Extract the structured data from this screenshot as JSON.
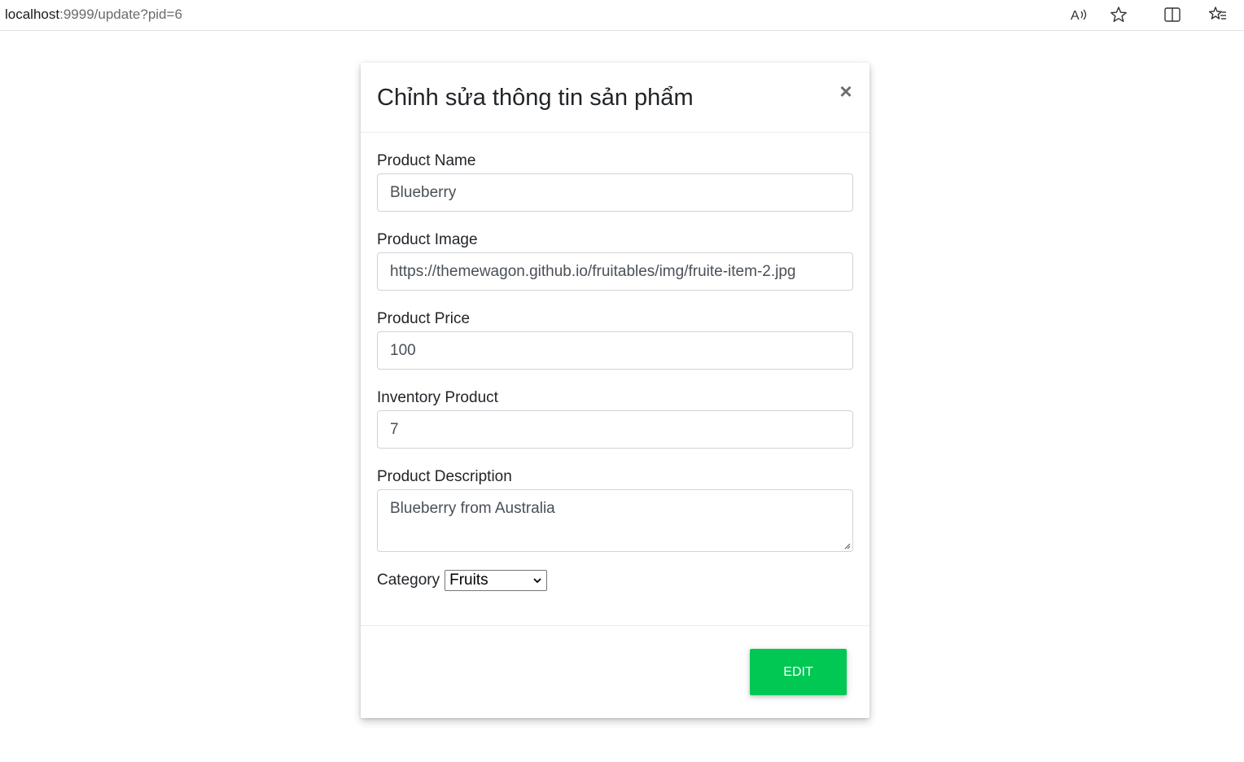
{
  "browser": {
    "url_host": "localhost",
    "url_rest": ":9999/update?pid=6",
    "icons": [
      "read-aloud-icon",
      "favorite-star-icon",
      "split-screen-icon",
      "favorites-list-icon"
    ]
  },
  "modal": {
    "title": "Chỉnh sửa thông tin sản phẩm",
    "close_glyph": "×",
    "fields": [
      {
        "label": "Product Name",
        "value": "Blueberry"
      },
      {
        "label": "Product Image",
        "value": "https://themewagon.github.io/fruitables/img/fruite-item-2.jpg"
      },
      {
        "label": "Product Price",
        "value": "100"
      },
      {
        "label": "Inventory Product",
        "value": "7"
      }
    ],
    "description": {
      "label": "Product Description",
      "value": "Blueberry from Australia"
    },
    "category": {
      "label": "Category",
      "selected": "Fruits"
    },
    "submit_label": "EDIT"
  },
  "colors": {
    "submit_button": "#00c853",
    "input_border": "#ced4da"
  }
}
